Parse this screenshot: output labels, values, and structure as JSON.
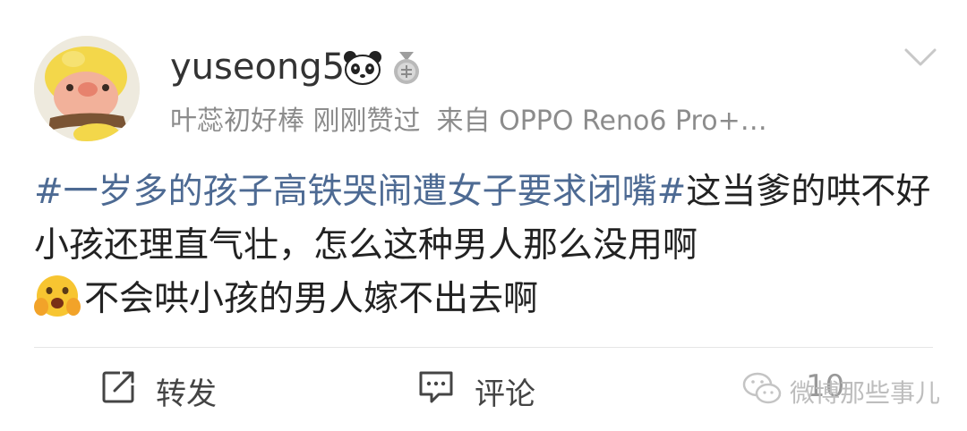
{
  "user": {
    "username": "yuseong5",
    "badges": [
      "panda-icon",
      "medal-icon"
    ]
  },
  "meta": {
    "liked_by": "叶蕊初好棒",
    "liked_status": "刚刚赞过",
    "source": "来自 OPPO Reno6 Pro+…"
  },
  "post": {
    "hashtag": "#一岁多的孩子高铁哭闹遭女子要求闭嘴#",
    "text1": "这当爹的哄不好小孩还理直气壮，怎么这种男人那么没用啊",
    "emoji": "hugging-face-icon",
    "text2": "不会哄小孩的男人嫁不出去啊"
  },
  "actions": {
    "repost_label": "转发",
    "comment_label": "评论",
    "like_count": "10"
  },
  "watermark": {
    "text": "微博那些事儿"
  },
  "colors": {
    "hashtag": "#4d6a93",
    "meta": "#8c8c8c",
    "divider": "#e6e6e6"
  }
}
